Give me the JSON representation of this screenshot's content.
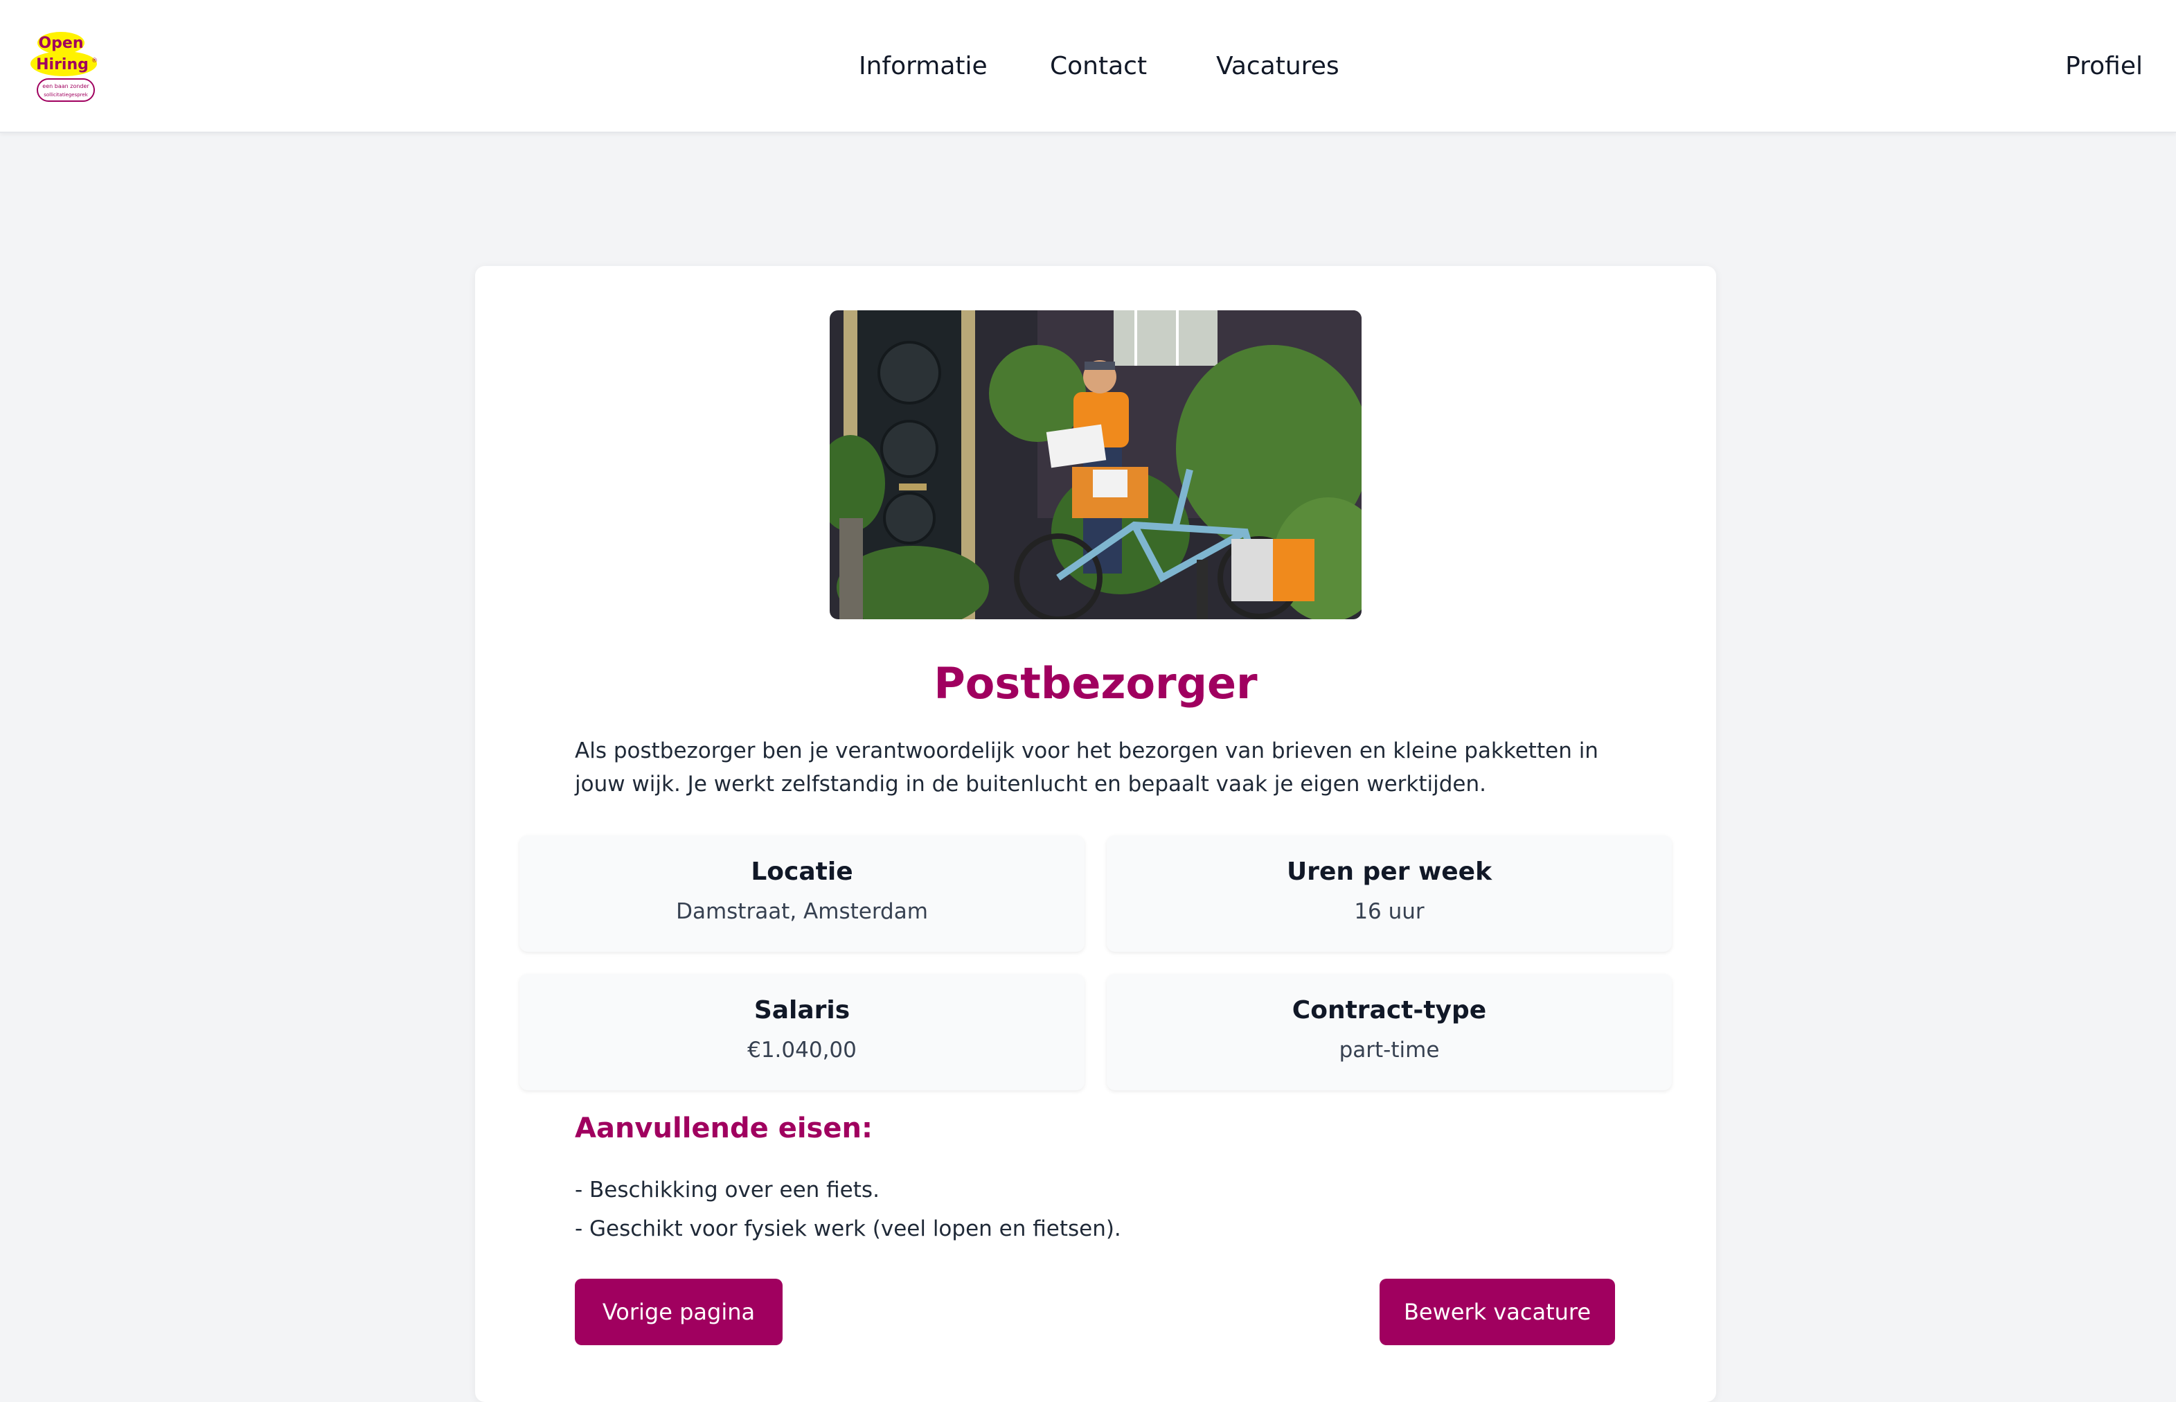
{
  "header": {
    "logo": {
      "line1": "Open",
      "line2": "Hiring",
      "registered": "®",
      "tagline1": "een baan zonder",
      "tagline2": "sollicitatiegesprek",
      "colors": {
        "yellow": "#fff200",
        "magenta": "#a0005f"
      }
    },
    "nav": [
      "Informatie",
      "Contact",
      "Vacatures"
    ],
    "profile": "Profiel"
  },
  "vacancy": {
    "image_alt": "postman-with-bicycle-photo",
    "title": "Postbezorger",
    "description": "Als postbezorger ben je verantwoordelijk voor het bezorgen van brieven en kleine pakketten in jouw wijk. Je werkt zelfstandig in de buitenlucht en bepaalt vaak je eigen werktijden.",
    "details": {
      "location": {
        "label": "Locatie",
        "value": "Damstraat, Amsterdam"
      },
      "hours": {
        "label": "Uren per week",
        "value": "16 uur"
      },
      "salary": {
        "label": "Salaris",
        "value": "€1.040,00"
      },
      "contract": {
        "label": "Contract-type",
        "value": "part-time"
      }
    },
    "requirements_title": "Aanvullende eisen:",
    "requirements": [
      "- Beschikking over een fiets.",
      "- Geschikt voor fysiek werk (veel lopen en fietsen)."
    ]
  },
  "buttons": {
    "back": "Vorige pagina",
    "edit": "Bewerk vacature"
  },
  "colors": {
    "accent": "#a0005f",
    "background": "#f3f4f6"
  }
}
